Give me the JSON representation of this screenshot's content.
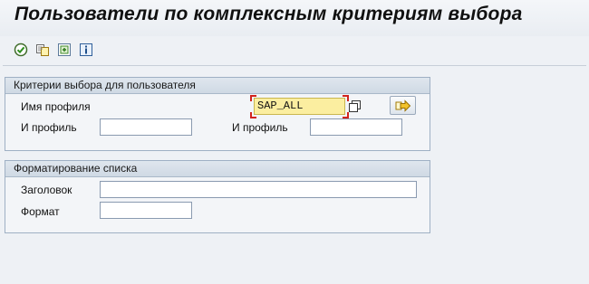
{
  "window": {
    "title": "Пользователи по комплексным критериям выбора"
  },
  "toolbar": {
    "buttons": [
      {
        "name": "execute-icon"
      },
      {
        "name": "get-variant-icon"
      },
      {
        "name": "selection-options-icon"
      },
      {
        "name": "info-icon"
      }
    ]
  },
  "user_criteria": {
    "header": "Критерии выбора для пользователя",
    "profile_name_label": "Имя профиля",
    "profile_name_value": "SAP_ALL",
    "and_profile_label_1": "И профиль",
    "and_profile_value_1": "",
    "and_profile_label_2": "И профиль",
    "and_profile_value_2": ""
  },
  "list_format": {
    "header": "Форматирование списка",
    "heading_label": "Заголовок",
    "heading_value": "",
    "format_label": "Формат",
    "format_value": ""
  },
  "colors": {
    "title_bg": "#eef1f5",
    "group_header_bg": "#d6dfe9",
    "group_border": "#9fb0c4",
    "required_field_bg": "#fbeea0",
    "focus_corners": "#d2241d"
  }
}
